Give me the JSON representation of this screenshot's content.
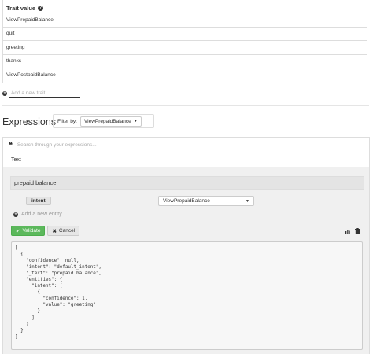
{
  "traits": {
    "header": "Trait value",
    "rows": [
      "ViewPrepaidBalance",
      "quit",
      "greeting",
      "thanks",
      "ViewPostpaidBalance"
    ],
    "add_placeholder": "Add a new trait"
  },
  "expressions": {
    "title": "Expressions",
    "filter_label": "Filter by:",
    "filter_value": "ViewPrepaidBalance",
    "search_placeholder": "Search through your expressions...",
    "text_tab": "Text"
  },
  "editor": {
    "expression_text": "prepaid balance",
    "entity_badge": "intent",
    "entity_value": "ViewPrepaidBalance",
    "add_entity": "Add a new entity",
    "validate_label": "Validate",
    "cancel_label": "Cancel",
    "json": "[\n  {\n    \"confidence\": null,\n    \"intent\": \"default_intent\",\n    \"_text\": \"prepaid balance\",\n    \"entities\": {\n      \"intent\": [\n        {\n          \"confidence\": 1,\n          \"value\": \"greeting\"\n        }\n      ]\n    }\n  }\n]"
  },
  "colors": {
    "validate_green": "#5cb85c",
    "panel_bg": "#f0f0f0"
  },
  "icons": {
    "help": "question-circle-icon",
    "add": "plus-circle-icon",
    "quote": "quote-left-icon",
    "check": "check-icon",
    "close": "times-icon",
    "chart": "bar-chart-icon",
    "trash": "trash-icon"
  }
}
